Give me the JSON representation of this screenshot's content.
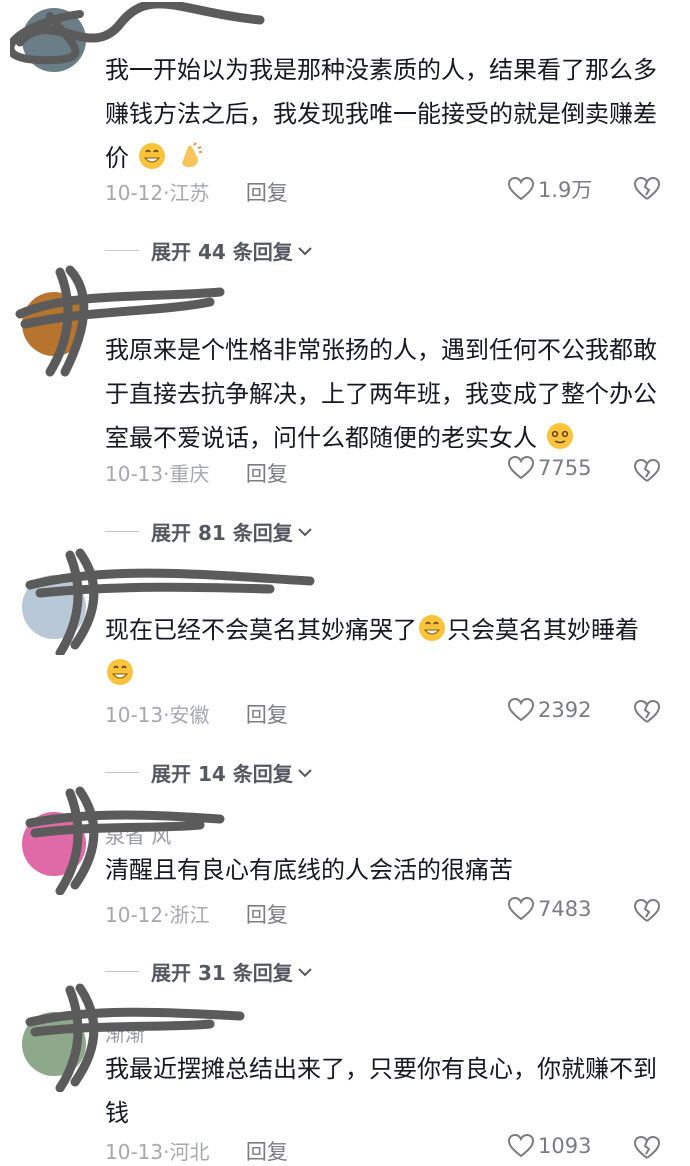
{
  "comments": [
    {
      "text_before": "我一开始以为我是那种没素质的人，结果看了那么多赚钱方法之后，我发现我唯一能接受的就是倒卖赚差价",
      "emoji": [
        "grin-emoji",
        "clap-emoji"
      ],
      "date": "10-12",
      "location": "江苏",
      "reply_label": "回复",
      "likes": "1.9万",
      "expand_label": "展开 44 条回复"
    },
    {
      "text_before": "我原来是个性格非常张扬的人，遇到任何不公我都敢于直接去抗争解决，上了两年班，我变成了整个办公室最不爱说话，问什么都随便的老实女人",
      "emoji": [
        "blush-emoji"
      ],
      "date": "10-13",
      "location": "重庆",
      "reply_label": "回复",
      "likes": "7755",
      "expand_label": "展开 81 条回复"
    },
    {
      "text_before": "现在已经不会莫名其妙痛哭了",
      "text_middle": "只会莫名其妙睡着",
      "emoji": [
        "grin-emoji",
        "grin-emoji"
      ],
      "date": "10-13",
      "location": "安徽",
      "reply_label": "回复",
      "likes": "2392",
      "expand_label": "展开 14 条回复"
    },
    {
      "username": "泉省 风",
      "text_before": "清醒且有良心有底线的人会活的很痛苦",
      "date": "10-12",
      "location": "浙江",
      "reply_label": "回复",
      "likes": "7483",
      "expand_label": "展开 31 条回复"
    },
    {
      "username": "渐渐",
      "text_before": "我最近摆摊总结出来了，只要你有良心，你就赚不到钱",
      "date": "10-13",
      "location": "河北",
      "reply_label": "回复",
      "likes": "1093"
    }
  ],
  "colors": {
    "text": "#161823",
    "meta": "#a6a8ad",
    "scribble": "#5b5b5b"
  }
}
